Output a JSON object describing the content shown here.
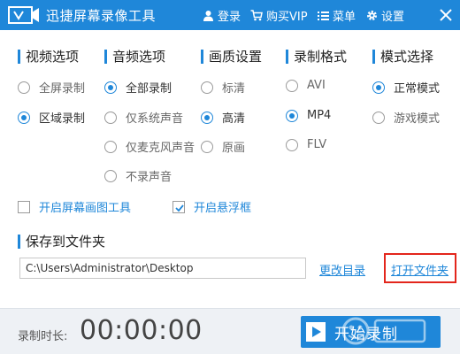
{
  "titlebar": {
    "app_title": "迅捷屏幕录像工具",
    "login": "登录",
    "buy_vip": "购买VIP",
    "menu": "菜单",
    "settings": "设置"
  },
  "sections": {
    "video": "视频选项",
    "audio": "音频选项",
    "quality": "画质设置",
    "format": "录制格式",
    "mode": "模式选择"
  },
  "video_options": [
    {
      "label": "全屏录制",
      "selected": false
    },
    {
      "label": "区域录制",
      "selected": true
    }
  ],
  "audio_options": [
    {
      "label": "全部录制",
      "selected": true
    },
    {
      "label": "仅系统声音",
      "selected": false
    },
    {
      "label": "仅麦克风声音",
      "selected": false
    },
    {
      "label": "不录声音",
      "selected": false
    }
  ],
  "quality_options": [
    {
      "label": "标清",
      "selected": false
    },
    {
      "label": "高清",
      "selected": true
    },
    {
      "label": "原画",
      "selected": false
    }
  ],
  "format_options": [
    {
      "label": "AVI",
      "selected": false
    },
    {
      "label": "MP4",
      "selected": true
    },
    {
      "label": "FLV",
      "selected": false
    }
  ],
  "mode_options": [
    {
      "label": "正常模式",
      "selected": true
    },
    {
      "label": "游戏模式",
      "selected": false
    }
  ],
  "checkboxes": {
    "drawing_tool": {
      "label": "开启屏幕画图工具",
      "checked": false
    },
    "floating_box": {
      "label": "开启悬浮框",
      "checked": true
    }
  },
  "save": {
    "heading": "保存到文件夹",
    "path": "C:\\Users\\Administrator\\Desktop",
    "change_dir": "更改目录",
    "open_folder": "打开文件夹"
  },
  "footer": {
    "duration_label": "录制时长:",
    "duration_value": "00:00:00",
    "start_label": "开始录制"
  },
  "colors": {
    "accent": "#1f87d9",
    "highlight": "#e3261c"
  }
}
